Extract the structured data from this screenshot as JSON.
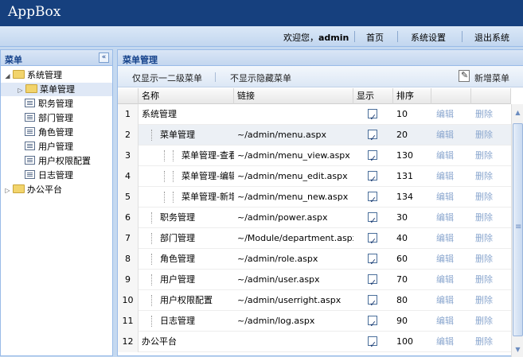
{
  "app": {
    "title": "AppBox"
  },
  "topnav": {
    "welcome_prefix": "欢迎您，",
    "username": "admin",
    "home": "首页",
    "settings": "系统设置",
    "logout": "退出系统"
  },
  "sidebar": {
    "title": "菜单",
    "collapse_glyph": "«",
    "tree": [
      {
        "label": "系统管理",
        "type": "folder",
        "expanded": true
      },
      {
        "label": "菜单管理",
        "type": "folder",
        "selected": true
      },
      {
        "label": "职务管理",
        "type": "leaf"
      },
      {
        "label": "部门管理",
        "type": "leaf"
      },
      {
        "label": "角色管理",
        "type": "leaf"
      },
      {
        "label": "用户管理",
        "type": "leaf"
      },
      {
        "label": "用户权限配置",
        "type": "leaf"
      },
      {
        "label": "日志管理",
        "type": "leaf"
      },
      {
        "label": "办公平台",
        "type": "folder",
        "expanded": false
      }
    ]
  },
  "main": {
    "title": "菜单管理",
    "toolbar": {
      "show_level12": "仅显示一二级菜单",
      "hide_hidden": "不显示隐藏菜单",
      "add_menu": "新增菜单"
    },
    "columns": [
      "名称",
      "链接",
      "显示",
      "排序"
    ],
    "edit_label": "编辑",
    "delete_label": "删除",
    "rows": [
      {
        "no": "1",
        "name": "系统管理",
        "link": "",
        "visible": true,
        "order": "10"
      },
      {
        "no": "2",
        "name": "菜单管理",
        "link": "~/admin/menu.aspx",
        "visible": true,
        "order": "20"
      },
      {
        "no": "3",
        "name": "菜单管理-查看",
        "link": "~/admin/menu_view.aspx",
        "visible": true,
        "order": "130"
      },
      {
        "no": "4",
        "name": "菜单管理-编辑",
        "link": "~/admin/menu_edit.aspx",
        "visible": true,
        "order": "131"
      },
      {
        "no": "5",
        "name": "菜单管理-新增",
        "link": "~/admin/menu_new.aspx",
        "visible": true,
        "order": "134"
      },
      {
        "no": "6",
        "name": "职务管理",
        "link": "~/admin/power.aspx",
        "visible": true,
        "order": "30"
      },
      {
        "no": "7",
        "name": "部门管理",
        "link": "~/Module/department.aspx",
        "visible": true,
        "order": "40"
      },
      {
        "no": "8",
        "name": "角色管理",
        "link": "~/admin/role.aspx",
        "visible": true,
        "order": "60"
      },
      {
        "no": "9",
        "name": "用户管理",
        "link": "~/admin/user.aspx",
        "visible": true,
        "order": "70"
      },
      {
        "no": "10",
        "name": "用户权限配置",
        "link": "~/admin/userright.aspx",
        "visible": true,
        "order": "80"
      },
      {
        "no": "11",
        "name": "日志管理",
        "link": "~/admin/log.aspx",
        "visible": true,
        "order": "90"
      },
      {
        "no": "12",
        "name": "办公平台",
        "link": "",
        "visible": true,
        "order": "100"
      }
    ]
  }
}
